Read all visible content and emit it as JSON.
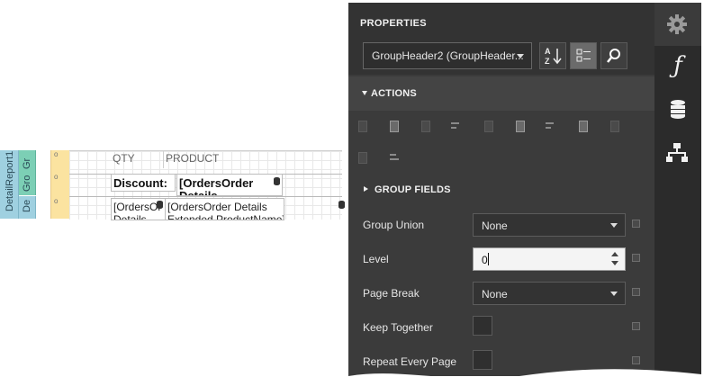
{
  "designer": {
    "bands": {
      "detail_report": "DetailReport1",
      "group_a": "Gro",
      "group_b": "Gr",
      "detail": "De"
    },
    "headers": {
      "qty": "QTY",
      "product": "PRODUCT"
    },
    "row1": {
      "discount_label": "Discount:",
      "orders_field": "[OrdersOrder",
      "orders_field_line2": "Details"
    },
    "row2": {
      "field1": "[OrdersOr",
      "field1_line2": "Details",
      "field2": "[OrdersOrder Details",
      "field2_line2": "Extended.ProductName]"
    }
  },
  "properties": {
    "title": "PROPERTIES",
    "selected_component": "GroupHeader2 (GroupHeader...",
    "toolbar": {
      "sort_icon": "sort-alphabetical-icon",
      "categories_icon": "categorized-icon",
      "search_icon": "search-icon"
    },
    "settings_icon": "gear-icon",
    "sections": {
      "actions": "ACTIONS",
      "group_fields": "GROUP FIELDS"
    },
    "fields": [
      {
        "label": "Group Union",
        "value": "None",
        "kind": "select"
      },
      {
        "label": "Level",
        "value": "0",
        "kind": "spin"
      },
      {
        "label": "Page Break",
        "value": "None",
        "kind": "select"
      },
      {
        "label": "Keep Together",
        "value": "",
        "kind": "checkbox"
      },
      {
        "label": "Repeat Every Page",
        "value": "",
        "kind": "checkbox"
      }
    ]
  },
  "side_tabs": [
    {
      "icon": "function-icon",
      "glyph": "ƒ"
    },
    {
      "icon": "database-icon",
      "glyph": ""
    },
    {
      "icon": "report-explorer-icon",
      "glyph": ""
    }
  ]
}
